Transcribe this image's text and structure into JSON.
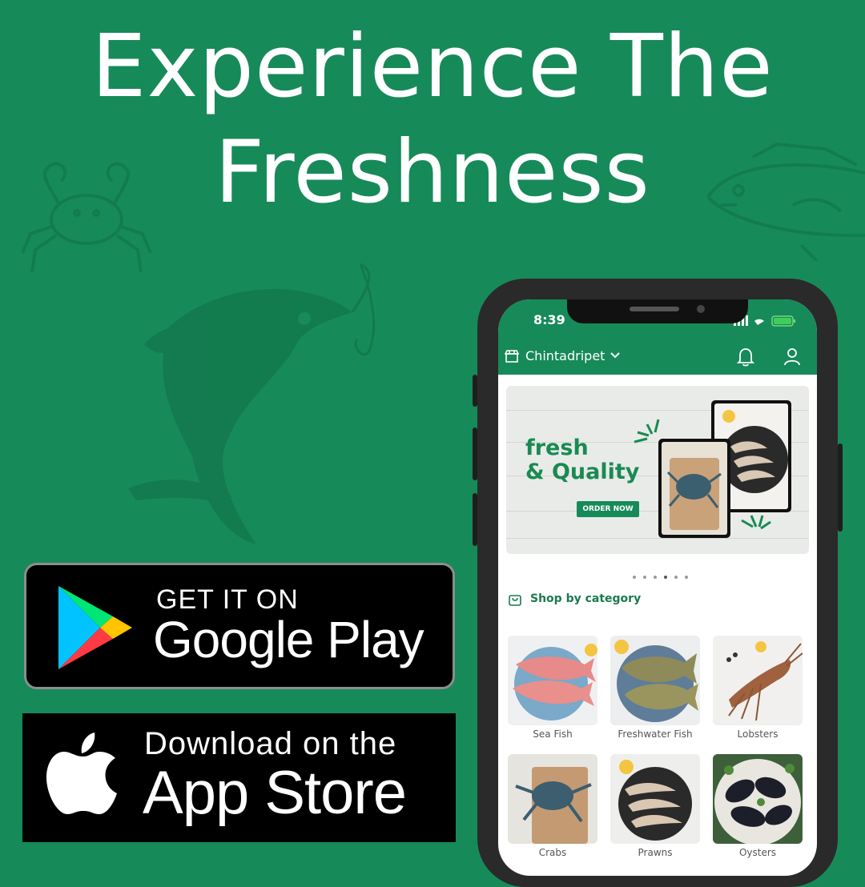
{
  "headline": {
    "line1": "Experience The",
    "line2": "Freshness"
  },
  "badges": {
    "google_play": {
      "small": "GET IT ON",
      "big": "Google Play"
    },
    "app_store": {
      "small": "Download on the",
      "big": "App Store"
    }
  },
  "phone": {
    "status": {
      "time": "8:39"
    },
    "appbar": {
      "location": "Chintadripet"
    },
    "banner": {
      "line1": "fresh",
      "line2": "& Quality",
      "cta": "ORDER NOW",
      "slide_count": 6,
      "active_slide": 4
    },
    "section_title": "Shop by category",
    "categories": [
      {
        "label": "Sea Fish"
      },
      {
        "label": "Freshwater Fish"
      },
      {
        "label": "Lobsters"
      },
      {
        "label": "Crabs"
      },
      {
        "label": "Prawns"
      },
      {
        "label": "Oysters"
      }
    ]
  },
  "colors": {
    "background": "#178a5a",
    "brand_green": "#1a8a52"
  }
}
